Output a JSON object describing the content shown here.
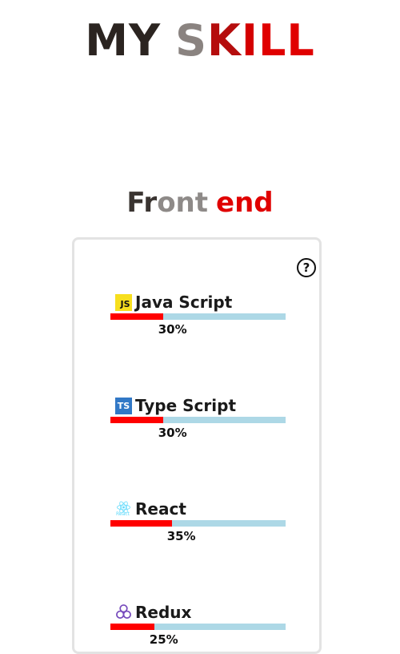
{
  "header": {
    "title_parts": [
      {
        "text": "M",
        "color": "#2b2420"
      },
      {
        "text": "Y",
        "color": "#2b2420"
      },
      {
        "text": " ",
        "color": "#2b2420"
      },
      {
        "text": "S",
        "color": "#8a8380"
      },
      {
        "text": "K",
        "color": "#b50d0d"
      },
      {
        "text": "I",
        "color": "#d40000"
      },
      {
        "text": "L",
        "color": "#e00000"
      },
      {
        "text": "L",
        "color": "#e00000"
      }
    ]
  },
  "section": {
    "title_parts": [
      {
        "text": "Fr",
        "color": "#3a3431"
      },
      {
        "text": "ont",
        "color": "#8e8a88"
      },
      {
        "text": " ",
        "color": "#8e8a88"
      },
      {
        "text": "end",
        "color": "#e00000"
      }
    ]
  },
  "card": {
    "help_icon": "question-circle-icon",
    "help_glyph": "?"
  },
  "skills": [
    {
      "name": "Java Script",
      "icon": "javascript-logo-icon",
      "icon_text": "JS",
      "percent_label": "30%",
      "level": 0.3
    },
    {
      "name": "Type Script",
      "icon": "typescript-logo-icon",
      "icon_text": "TS",
      "percent_label": "30%",
      "level": 0.3
    },
    {
      "name": "React",
      "icon": "react-logo-icon",
      "icon_text": "React",
      "percent_label": "35%",
      "level": 0.35
    },
    {
      "name": "Redux",
      "icon": "redux-logo-icon",
      "icon_text": "",
      "percent_label": "25%",
      "level": 0.25
    }
  ],
  "colors": {
    "bar_fill": "#ff0000",
    "bar_track": "#add8e6",
    "card_border": "#e3e3e3"
  }
}
